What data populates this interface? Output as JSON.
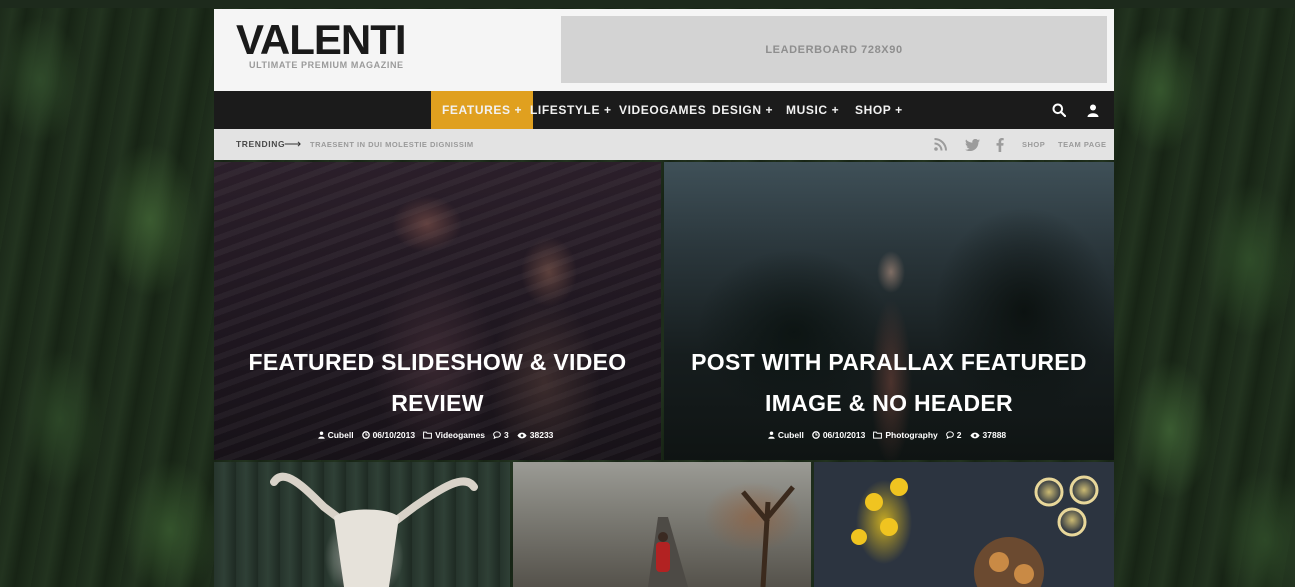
{
  "header": {
    "logo_title": "VALENTI",
    "logo_tagline": "ULTIMATE PREMIUM MAGAZINE",
    "leaderboard_label": "LEADERBOARD 728X90"
  },
  "nav": {
    "items": [
      {
        "label": "FEATURES +",
        "active": true
      },
      {
        "label": "LIFESTYLE +"
      },
      {
        "label": "VIDEOGAMES"
      },
      {
        "label": "DESIGN +"
      },
      {
        "label": "MUSIC +"
      },
      {
        "label": "SHOP +"
      }
    ],
    "icons": [
      "search-icon",
      "user-icon"
    ],
    "accent_color": "#e0a01f"
  },
  "trending": {
    "label": "TRENDING",
    "arrow": "⟶",
    "text": "TRAESENT IN DUI MOLESTIE DIGNISSIM",
    "social_icons": [
      "rss-icon",
      "twitter-icon",
      "facebook-icon"
    ],
    "links": [
      "SHOP",
      "TEAM PAGE"
    ]
  },
  "featured": [
    {
      "title_line1": "FEATURED SLIDESHOW & VIDEO",
      "title_line2": "REVIEW",
      "author": "Cubell",
      "date": "06/10/2013",
      "category": "Videogames",
      "comments": "3",
      "views": "38233"
    },
    {
      "title_line1": "POST WITH PARALLAX FEATURED",
      "title_line2": "IMAGE & NO HEADER",
      "author": "Cubell",
      "date": "06/10/2013",
      "category": "Photography",
      "comments": "2",
      "views": "37888"
    }
  ]
}
